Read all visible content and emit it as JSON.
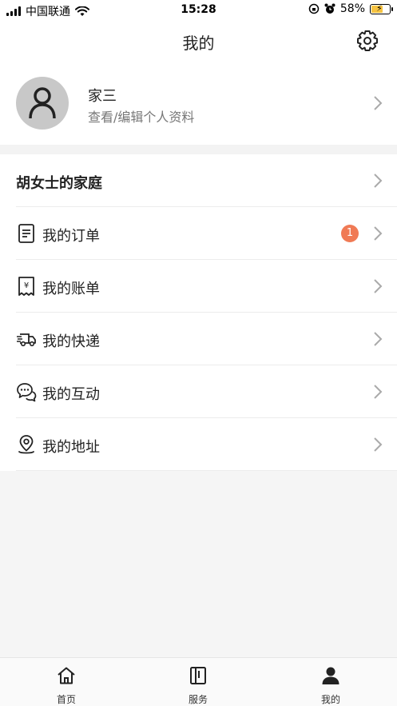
{
  "status_bar": {
    "carrier": "中国联通",
    "time": "15:28",
    "battery": "58%",
    "battery_level": 0.58
  },
  "header": {
    "title": "我的"
  },
  "profile": {
    "name": "家三",
    "subtitle": "查看/编辑个人资料"
  },
  "menu": {
    "family": "胡女士的家庭",
    "items": [
      {
        "label": "我的订单",
        "icon": "document-icon",
        "badge": "1"
      },
      {
        "label": "我的账单",
        "icon": "receipt-yen-icon"
      },
      {
        "label": "我的快递",
        "icon": "truck-icon"
      },
      {
        "label": "我的互动",
        "icon": "chat-bubbles-icon"
      },
      {
        "label": "我的地址",
        "icon": "location-pin-icon"
      }
    ]
  },
  "tabbar": {
    "tabs": [
      {
        "label": "首页",
        "icon": "home-icon"
      },
      {
        "label": "服务",
        "icon": "book-icon"
      },
      {
        "label": "我的",
        "icon": "person-icon",
        "active": true
      }
    ]
  },
  "colors": {
    "badge": "#f07a55",
    "battery_fill": "#f6c342",
    "background": "#f5f5f5"
  }
}
